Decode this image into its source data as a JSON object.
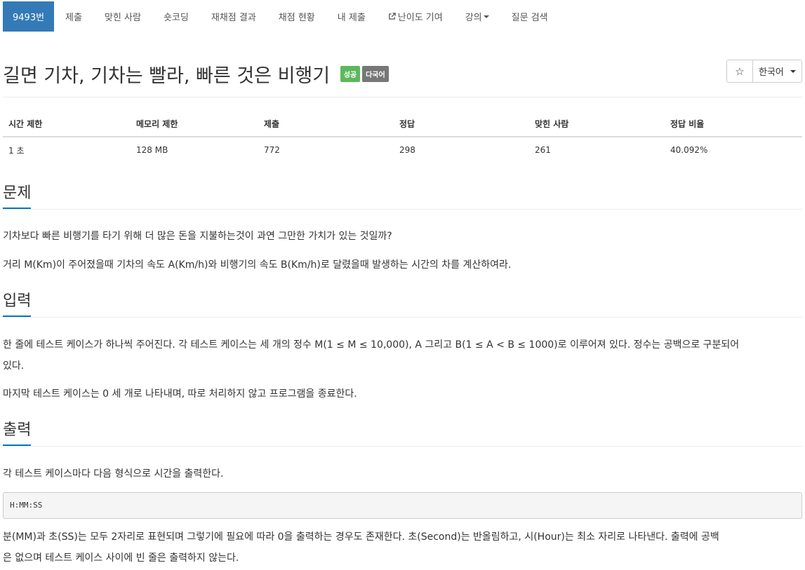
{
  "nav": {
    "items": [
      {
        "label": "9493번",
        "active": true
      },
      {
        "label": "제출"
      },
      {
        "label": "맞힌 사람"
      },
      {
        "label": "숏코딩"
      },
      {
        "label": "재채점 결과"
      },
      {
        "label": "채점 현황"
      },
      {
        "label": "내 제출"
      },
      {
        "label": "난이도 기여",
        "icon": "external-link-icon"
      },
      {
        "label": "강의",
        "icon": "caret-down-icon"
      },
      {
        "label": "질문 검색"
      }
    ]
  },
  "problem": {
    "title": "길면 기차, 기차는 빨라, 빠른 것은 비행기",
    "badges": [
      "성공",
      "다국어"
    ],
    "star_icon": "☆",
    "language": "한국어"
  },
  "info_table": {
    "headers": [
      "시간 제한",
      "메모리 제한",
      "제출",
      "정답",
      "맞힌 사람",
      "정답 비율"
    ],
    "values": [
      "1 초",
      "128 MB",
      "772",
      "298",
      "261",
      "40.092%"
    ]
  },
  "sections": {
    "problem": {
      "heading": "문제",
      "paragraphs": [
        "기차보다 빠른 비행기를 타기 위해 더 많은 돈을 지불하는것이 과연 그만한 가치가 있는 것일까?",
        "거리 M(Km)이 주어졌을때 기차의 속도 A(Km/h)와 비행기의 속도 B(Km/h)로 달렸을때 발생하는 시간의 차를 계산하여라."
      ]
    },
    "input": {
      "heading": "입력",
      "paragraphs": [
        "한 줄에 테스트 케이스가 하나씩 주어진다. 각 테스트 케이스는 세 개의 정수 M(1 ≤ M ≤ 10,000), A 그리고 B(1 ≤ A < B ≤ 1000)로 이루어져 있다. 정수는 공백으로 구분되어",
        "있다.",
        "마지막 테스트 케이스는 0 세 개로 나타내며, 따로 처리하지 않고 프로그램을 종료한다."
      ]
    },
    "output": {
      "heading": "출력",
      "paragraphs": [
        "각 테스트 케이스마다 다음 형식으로 시간을 출력한다.",
        "분(MM)과 초(SS)는 모두 2자리로 표현되며 그렇기에 필요에 따라 0을 출력하는 경우도 존재한다. 초(Second)는 반올림하고, 시(Hour)는 최소 자리로 나타낸다. 출력에 공백",
        "은 없으며 테스트 케이스 사이에 빈 줄은 출력하지 않는다."
      ],
      "format": "H:MM:SS"
    }
  },
  "colors": {
    "nav_active": "#337ab7",
    "badge_success": "#5cb85c",
    "badge_default": "#777777",
    "heading_underline": "#0076c0"
  }
}
